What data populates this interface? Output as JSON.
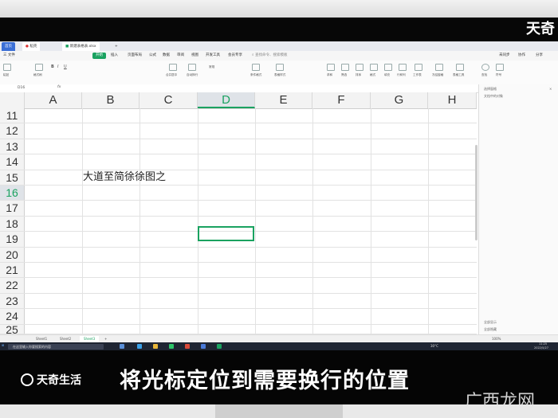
{
  "brand": {
    "top_logo": "天奇",
    "bottom_logo": "天奇生活",
    "watermark": "广西龙网"
  },
  "caption": "将光标定位到需要换行的位置",
  "app": {
    "tabs": [
      {
        "label": "首页"
      },
      {
        "label": "稻壳"
      },
      {
        "label": "新建表格表.xlsx"
      }
    ],
    "menus": [
      "三 文件",
      "开始",
      "插入",
      "页面布局",
      "公式",
      "数据",
      "审阅",
      "视图",
      "开发工具",
      "会员专享"
    ],
    "active_menu": "开始",
    "menu_search": "查找命令、搜索模板",
    "right_menu": [
      "未同步",
      "协作",
      "分享"
    ],
    "ribbon_labels": [
      "粘贴",
      "格式刷",
      "合并居中",
      "自动换行",
      "常规",
      "条件格式",
      "表格样式",
      "求和",
      "筛选",
      "排序",
      "格式",
      "填充",
      "行和列",
      "工作表",
      "冻结窗格",
      "表格工具",
      "查找",
      "符号"
    ],
    "name_box": "D16",
    "formula_fx": "fx"
  },
  "grid": {
    "columns": [
      "A",
      "B",
      "C",
      "D",
      "E",
      "F",
      "G",
      "H"
    ],
    "selected_column": "D",
    "rows": [
      "11",
      "12",
      "13",
      "14",
      "15",
      "16",
      "17",
      "18",
      "19",
      "20",
      "21",
      "22",
      "23",
      "24",
      "25"
    ],
    "selected_row": "16",
    "cell_text": "大道至简徐徐图之"
  },
  "right_panel": {
    "title": "选择窗格",
    "subtitle": "文档中的对象",
    "footer_1": "全部显示",
    "footer_2": "全部隐藏"
  },
  "sheets": [
    "Sheet1",
    "Sheet2",
    "Sheet3"
  ],
  "active_sheet": "Sheet3",
  "taskbar": {
    "search": "在这里输入你要搜索的内容",
    "weather": "30°C",
    "time": "11:25",
    "date": "2022/5/27",
    "zoom": "100%"
  }
}
